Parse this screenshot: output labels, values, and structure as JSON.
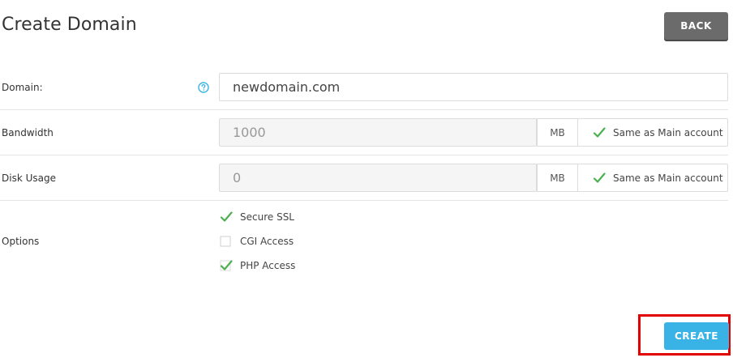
{
  "page": {
    "title": "Create Domain"
  },
  "header": {
    "back_label": "BACK"
  },
  "form": {
    "domain": {
      "label": "Domain:",
      "value": "newdomain.com"
    },
    "bandwidth": {
      "label": "Bandwidth",
      "value": "1000",
      "unit": "MB",
      "same_label": "Same as Main account",
      "same_checked": true
    },
    "disk": {
      "label": "Disk Usage",
      "value": "0",
      "unit": "MB",
      "same_label": "Same as Main account",
      "same_checked": true
    },
    "options": {
      "label": "Options",
      "items": [
        {
          "label": "Secure SSL",
          "checked": true
        },
        {
          "label": "CGI Access",
          "checked": false
        },
        {
          "label": "PHP Access",
          "checked": true
        }
      ]
    }
  },
  "footer": {
    "create_label": "CREATE"
  },
  "colors": {
    "accent": "#39b3e6",
    "check": "#4caf50",
    "back": "#6b6b6b",
    "highlight": "#e30000"
  },
  "icons": {
    "help": "question-circle-icon",
    "check": "checkmark-icon"
  }
}
